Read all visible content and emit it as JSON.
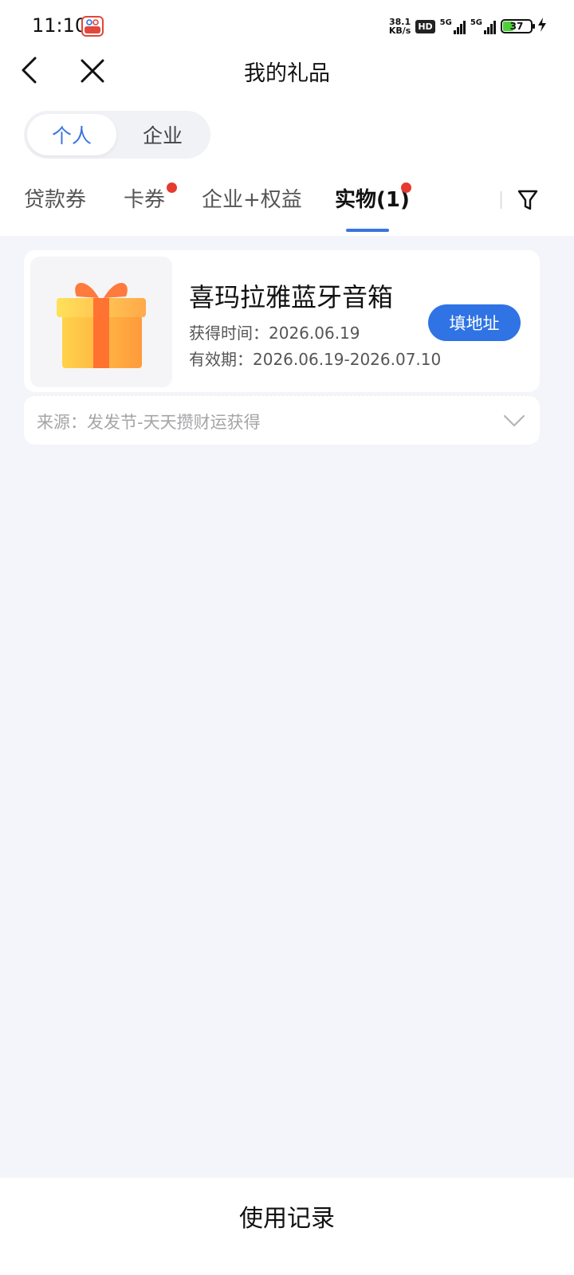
{
  "status_bar": {
    "time": "11:10",
    "net_speed_value": "38.1",
    "net_speed_unit": "KB/s",
    "hd_label": "HD",
    "signal_1_label": "5G",
    "signal_2_label": "5G",
    "battery_level": "37",
    "icons": [
      "app-notification-icon",
      "hd-icon",
      "signal-icon",
      "battery-icon",
      "charging-icon"
    ]
  },
  "nav": {
    "title": "我的礼品",
    "icons": [
      "back-icon",
      "close-icon"
    ]
  },
  "segment": {
    "options": [
      "个人",
      "企业"
    ],
    "selected": "个人"
  },
  "tabs": {
    "items": [
      "贷款券",
      "卡券",
      "企业+权益",
      "实物(1)"
    ],
    "active": "实物(1)",
    "filter_icon": "filter-icon"
  },
  "gift_card": {
    "name": "喜玛拉雅蓝牙音箱",
    "obtain_time": "获得时间：2026.06.19",
    "validity": "有效期：2026.06.19-2026.07.10",
    "action_label": "填地址",
    "source": "来源：发发节-天天攒财运获得",
    "image_icon": "gift-box-icon",
    "expand_icon": "chevron-down-icon"
  },
  "footer": {
    "label": "使用记录"
  },
  "colors": {
    "accent": "#2f73e4",
    "badge": "#e53a2f",
    "background": "#f4f5fa"
  }
}
